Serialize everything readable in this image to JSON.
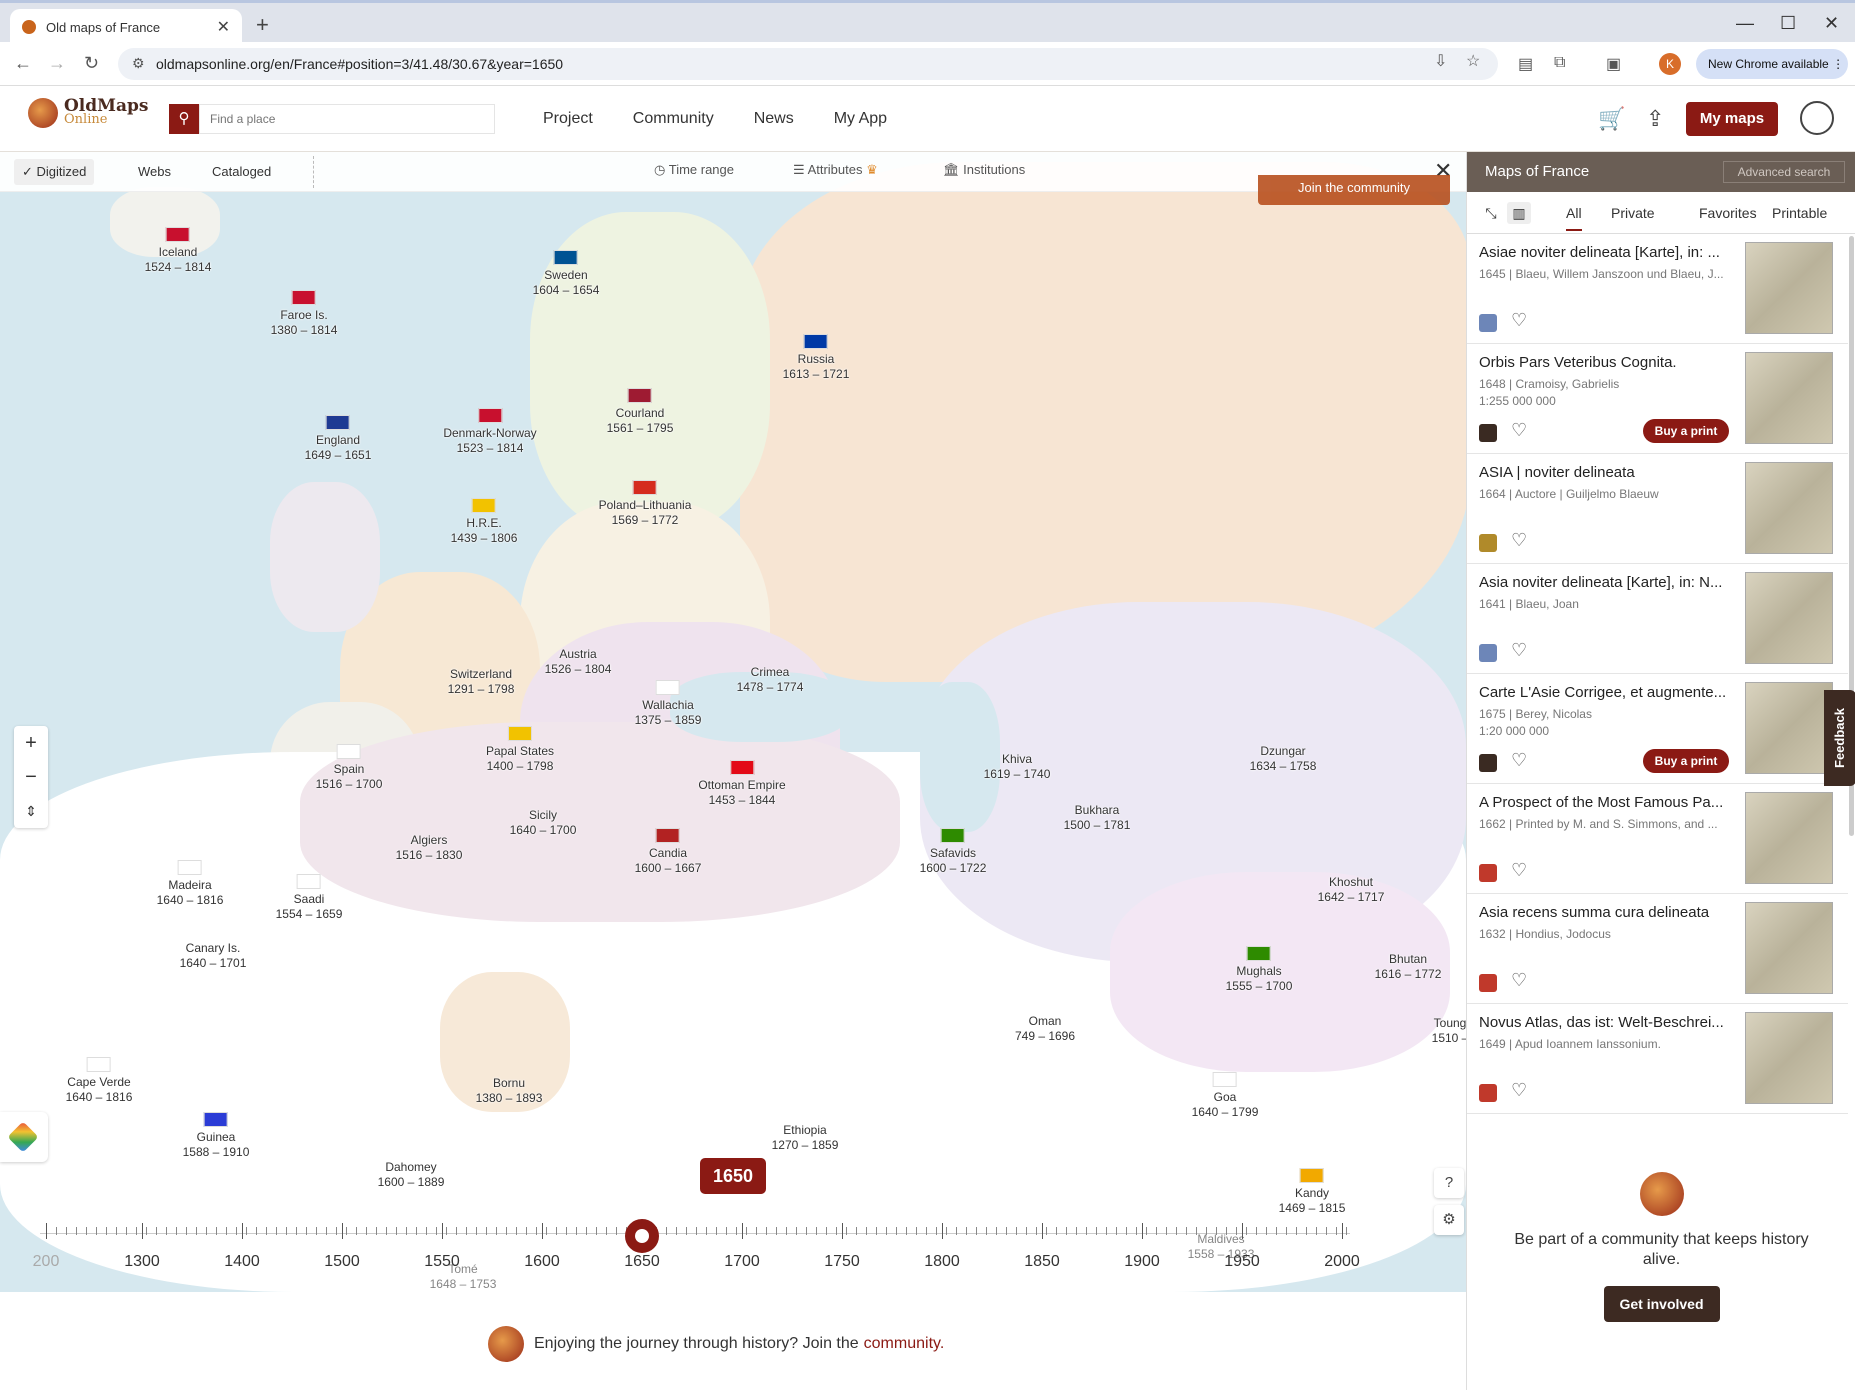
{
  "browser": {
    "tab_title": "Old maps of France",
    "url": "oldmapsonline.org/en/France#position=3/41.48/30.67&year=1650",
    "new_chrome": "New Chrome available",
    "profile_initial": "K"
  },
  "site": {
    "logo_line1": "OldMaps",
    "logo_line2": "Online",
    "search_placeholder": "Find a place",
    "nav": [
      "Project",
      "Community",
      "News",
      "My App"
    ],
    "my_maps": "My maps"
  },
  "filters": {
    "digitized": "✓ Digitized",
    "webs": "Webs",
    "cataloged": "Cataloged",
    "time_range": "Time range",
    "attributes": "Attributes",
    "institutions": "Institutions",
    "join_community": "Join the community"
  },
  "places": [
    {
      "name": "Iceland",
      "years": "1524 – 1814",
      "flag": "#c8102e"
    },
    {
      "name": "Faroe Is.",
      "years": "1380 – 1814",
      "flag": "#c8102e"
    },
    {
      "name": "Sweden",
      "years": "1604 – 1654",
      "flag": "#005293"
    },
    {
      "name": "Russia",
      "years": "1613 – 1721",
      "flag": "#0039a6"
    },
    {
      "name": "Courland",
      "years": "1561 – 1795",
      "flag": "#9e1b32"
    },
    {
      "name": "England",
      "years": "1649 – 1651",
      "flag": "#1f3a93"
    },
    {
      "name": "Denmark-Norway",
      "years": "1523 – 1814",
      "flag": "#c8102e"
    },
    {
      "name": "Poland–Lithuania",
      "years": "1569 – 1772",
      "flag": "#d52b1e"
    },
    {
      "name": "H.R.E.",
      "years": "1439 – 1806",
      "flag": "#f2c200"
    },
    {
      "name": "Austria",
      "years": "1526 – 1804",
      "flag": ""
    },
    {
      "name": "Crimea",
      "years": "1478 – 1774",
      "flag": ""
    },
    {
      "name": "Switzerland",
      "years": "1291 – 1798",
      "flag": ""
    },
    {
      "name": "Wallachia",
      "years": "1375 – 1859",
      "flag": "#ffffff"
    },
    {
      "name": "Spain",
      "years": "1516 – 1700",
      "flag": "#ffffff"
    },
    {
      "name": "Papal States",
      "years": "1400 – 1798",
      "flag": "#f2c200"
    },
    {
      "name": "Ottoman Empire",
      "years": "1453 – 1844",
      "flag": "#e30a17"
    },
    {
      "name": "Sicily",
      "years": "1640 – 1700",
      "flag": ""
    },
    {
      "name": "Algiers",
      "years": "1516 – 1830",
      "flag": ""
    },
    {
      "name": "Candia",
      "years": "1600 – 1667",
      "flag": "#b22222"
    },
    {
      "name": "Khiva",
      "years": "1619 – 1740",
      "flag": ""
    },
    {
      "name": "Dzungar",
      "years": "1634 – 1758",
      "flag": ""
    },
    {
      "name": "Bukhara",
      "years": "1500 – 1781",
      "flag": ""
    },
    {
      "name": "Safavids",
      "years": "1600 – 1722",
      "flag": "#2e8b00"
    },
    {
      "name": "Khoshut",
      "years": "1642 – 1717",
      "flag": ""
    },
    {
      "name": "Madeira",
      "years": "1640 – 1816",
      "flag": "#ffffff"
    },
    {
      "name": "Saadi",
      "years": "1554 – 1659",
      "flag": "#ffffff"
    },
    {
      "name": "Canary Is.",
      "years": "1640 – 1701",
      "flag": ""
    },
    {
      "name": "Mughals",
      "years": "1555 – 1700",
      "flag": "#2e8b00"
    },
    {
      "name": "Bhutan",
      "years": "1616 – 1772",
      "flag": ""
    },
    {
      "name": "Oman",
      "years": "749 – 1696",
      "flag": ""
    },
    {
      "name": "Toung",
      "years": "1510 –",
      "flag": ""
    },
    {
      "name": "Cape Verde",
      "years": "1640 – 1816",
      "flag": "#ffffff"
    },
    {
      "name": "Bornu",
      "years": "1380 – 1893",
      "flag": ""
    },
    {
      "name": "Goa",
      "years": "1640 – 1799",
      "flag": "#ffffff"
    },
    {
      "name": "Guinea",
      "years": "1588 – 1910",
      "flag": "#2b3cd6"
    },
    {
      "name": "Ethiopia",
      "years": "1270 – 1859",
      "flag": ""
    },
    {
      "name": "Dahomey",
      "years": "1600 – 1889",
      "flag": ""
    },
    {
      "name": "Kandy",
      "years": "1469 – 1815",
      "flag": "#f2a900"
    },
    {
      "name": "Maldives",
      "years": "1558 – 1933",
      "flag": ""
    },
    {
      "name": "Tomé",
      "years": "1648 – 1753",
      "flag": ""
    }
  ],
  "timeline": {
    "current_year": "1650",
    "labels": [
      "200",
      "1300",
      "1400",
      "1500",
      "1550",
      "1600",
      "1650",
      "1700",
      "1750",
      "1800",
      "1850",
      "1900",
      "1950",
      "2000"
    ]
  },
  "bottom_banner": {
    "text": "Enjoying the journey through history? Join the",
    "link": "community."
  },
  "sidebar": {
    "title": "Maps of France",
    "advanced_search": "Advanced search",
    "tabs": [
      "All",
      "Private",
      "Favorites",
      "Printable"
    ],
    "items": [
      {
        "title": "Asiae noviter delineata [Karte], in: ...",
        "meta": "1645 | Blaeu, Willem Janszoon und Blaeu, J...",
        "scale": "",
        "buy": "",
        "src": "#6d86b8"
      },
      {
        "title": "Orbis Pars Veteribus Cognita.",
        "meta": "1648 | Cramoisy, Gabrielis",
        "scale": "1:255 000 000",
        "buy": "Buy a print",
        "src": "#3a2a22"
      },
      {
        "title": "ASIA | noviter delineata",
        "meta": "1664 | Auctore | Guiljelmo Blaeuw",
        "scale": "",
        "buy": "",
        "src": "#b08a2a"
      },
      {
        "title": "Asia noviter delineata [Karte], in: N...",
        "meta": "1641 | Blaeu, Joan",
        "scale": "",
        "buy": "",
        "src": "#6d86b8"
      },
      {
        "title": "Carte L'Asie Corrigee, et augmente...",
        "meta": "1675 | Berey, Nicolas",
        "scale": "1:20 000 000",
        "buy": "Buy a print",
        "src": "#3a2a22"
      },
      {
        "title": "A Prospect of the Most Famous Pa...",
        "meta": "1662 | Printed by M. and S. Simmons, and ...",
        "scale": "",
        "buy": "",
        "src": "#c0392b"
      },
      {
        "title": "Asia recens summa cura delineata",
        "meta": "1632 | Hondius, Jodocus",
        "scale": "",
        "buy": "",
        "src": "#c0392b"
      },
      {
        "title": "Novus Atlas, das ist: Welt-Beschrei...",
        "meta": "1649 | Apud Ioannem Ianssonium.",
        "scale": "",
        "buy": "",
        "src": "#c0392b"
      }
    ],
    "feedback": "Feedback",
    "community_text": "Be part of a community that keeps history alive.",
    "get_involved": "Get involved"
  }
}
